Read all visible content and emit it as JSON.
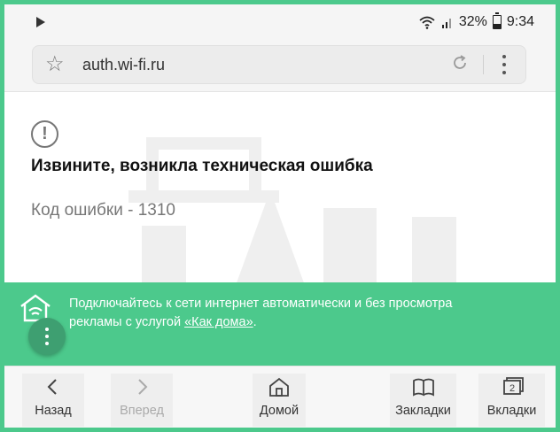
{
  "status_bar": {
    "battery": "32%",
    "time": "9:34"
  },
  "browser": {
    "url": "auth.wi-fi.ru"
  },
  "error": {
    "title": "Извините, возникла техническая ошибка",
    "code": "Код ошибки - 1310"
  },
  "banner": {
    "text": "Подключайтесь к сети интернет автоматически и без просмотра рекламы с услугой ",
    "link": "«Как дома»",
    "suffix": "."
  },
  "nav": {
    "back": "Назад",
    "forward": "Вперед",
    "home": "Домой",
    "bookmarks": "Закладки",
    "tabs": "Вкладки",
    "tabs_count": "2"
  },
  "colors": {
    "accent": "#4cc98c",
    "fab": "#3e9f71"
  },
  "icons": [
    "play-icon",
    "wifi-icon",
    "signal-icon",
    "battery-icon",
    "star-icon",
    "reload-icon",
    "menu-icon",
    "error-icon",
    "home-wifi-icon",
    "back-icon",
    "forward-icon",
    "home-icon",
    "bookmarks-icon",
    "tabs-icon"
  ]
}
